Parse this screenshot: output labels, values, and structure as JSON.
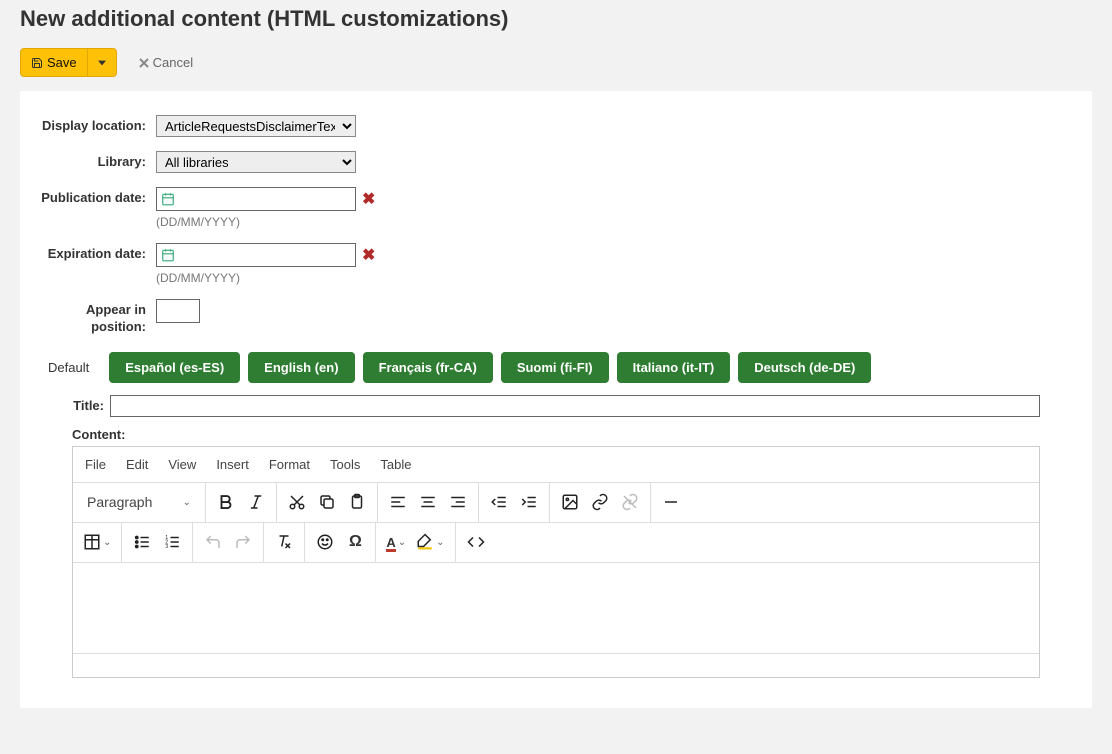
{
  "page_title": "New additional content (HTML customizations)",
  "toolbar": {
    "save_label": "Save",
    "cancel_label": "Cancel"
  },
  "form": {
    "display_location": {
      "label": "Display location:",
      "selected": "ArticleRequestsDisclaimerText"
    },
    "library": {
      "label": "Library:",
      "selected": "All libraries"
    },
    "pub_date": {
      "label": "Publication date:",
      "value": "",
      "hint": "(DD/MM/YYYY)"
    },
    "exp_date": {
      "label": "Expiration date:",
      "value": "",
      "hint": "(DD/MM/YYYY)"
    },
    "position": {
      "label": "Appear in position:",
      "value": ""
    }
  },
  "tabs": [
    "Default",
    "Español (es-ES)",
    "English (en)",
    "Français (fr-CA)",
    "Suomi (fi-FI)",
    "Italiano (it-IT)",
    "Deutsch (de-DE)"
  ],
  "editor": {
    "title_label": "Title:",
    "title_value": "",
    "content_label": "Content:",
    "menubar": [
      "File",
      "Edit",
      "View",
      "Insert",
      "Format",
      "Tools",
      "Table"
    ],
    "block_format": "Paragraph"
  }
}
